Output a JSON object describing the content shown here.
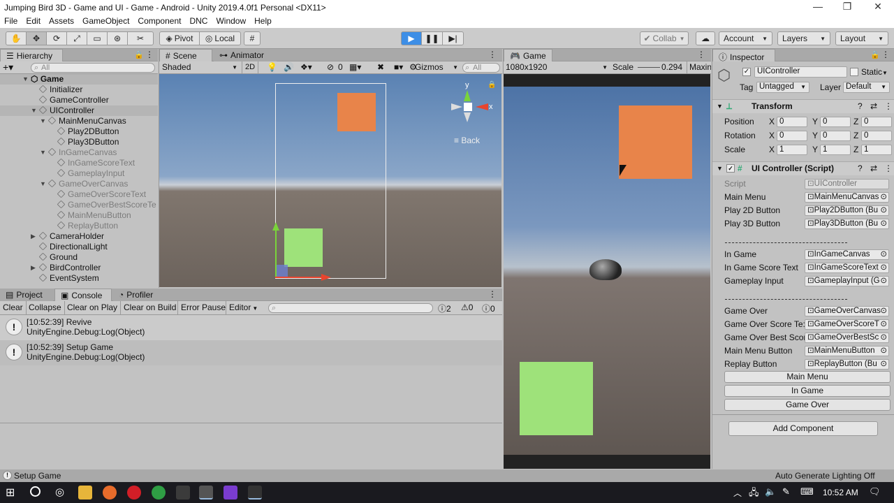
{
  "window": {
    "title": "Jumping Bird 3D - Game and UI - Game - Android - Unity 2019.4.0f1 Personal <DX11>"
  },
  "menu": [
    "File",
    "Edit",
    "Assets",
    "GameObject",
    "Component",
    "DNC",
    "Window",
    "Help"
  ],
  "toolbar": {
    "pivot": "Pivot",
    "local": "Local",
    "collab": "Collab",
    "account": "Account",
    "layers": "Layers",
    "layout": "Layout"
  },
  "hierarchy": {
    "tab": "Hierarchy",
    "search_placeholder": "All",
    "root": "Game",
    "items": [
      {
        "label": "Initializer",
        "level": 1,
        "arrow": "",
        "dim": false
      },
      {
        "label": "GameController",
        "level": 1,
        "arrow": "",
        "dim": false
      },
      {
        "label": "UIController",
        "level": 1,
        "arrow": "▼",
        "dim": false
      },
      {
        "label": "MainMenuCanvas",
        "level": 2,
        "arrow": "▼",
        "dim": false
      },
      {
        "label": "Play2DButton",
        "level": 3,
        "arrow": "",
        "dim": false
      },
      {
        "label": "Play3DButton",
        "level": 3,
        "arrow": "",
        "dim": false
      },
      {
        "label": "InGameCanvas",
        "level": 2,
        "arrow": "▼",
        "dim": true
      },
      {
        "label": "InGameScoreText",
        "level": 3,
        "arrow": "",
        "dim": true
      },
      {
        "label": "GameplayInput",
        "level": 3,
        "arrow": "",
        "dim": true
      },
      {
        "label": "GameOverCanvas",
        "level": 2,
        "arrow": "▼",
        "dim": true
      },
      {
        "label": "GameOverScoreText",
        "level": 3,
        "arrow": "",
        "dim": true
      },
      {
        "label": "GameOverBestScoreTe",
        "level": 3,
        "arrow": "",
        "dim": true
      },
      {
        "label": "MainMenuButton",
        "level": 3,
        "arrow": "",
        "dim": true
      },
      {
        "label": "ReplayButton",
        "level": 3,
        "arrow": "",
        "dim": true
      },
      {
        "label": "CameraHolder",
        "level": 1,
        "arrow": "▶",
        "dim": false
      },
      {
        "label": "DirectionalLight",
        "level": 1,
        "arrow": "",
        "dim": false
      },
      {
        "label": "Ground",
        "level": 1,
        "arrow": "",
        "dim": false
      },
      {
        "label": "BirdController",
        "level": 1,
        "arrow": "▶",
        "dim": false
      },
      {
        "label": "EventSystem",
        "level": 1,
        "arrow": "",
        "dim": false
      }
    ]
  },
  "scene": {
    "tabs": [
      "Scene",
      "Animator"
    ],
    "shading": "Shaded",
    "mode2d": "2D",
    "hidden_count": "0",
    "gizmos": "Gizmos",
    "search_placeholder": "All",
    "gizmo_back": "Back",
    "axis_y": "y",
    "axis_x": "x"
  },
  "game": {
    "tab": "Game",
    "resolution": "1080x1920",
    "scale_label": "Scale",
    "scale_value": "0.294",
    "maximize": "Maxin"
  },
  "console": {
    "tabs": [
      "Project",
      "Console",
      "Profiler"
    ],
    "buttons": [
      "Clear",
      "Collapse",
      "Clear on Play",
      "Clear on Build",
      "Error Pause",
      "Editor"
    ],
    "counts": {
      "warnings": "2",
      "info": "0",
      "errors": "0"
    },
    "logs": [
      {
        "line1": "[10:52:39] Revive",
        "line2": "UnityEngine.Debug:Log(Object)"
      },
      {
        "line1": "[10:52:39] Setup Game",
        "line2": "UnityEngine.Debug:Log(Object)"
      }
    ]
  },
  "inspector": {
    "tab": "Inspector",
    "object_name": "UIController",
    "static_label": "Static",
    "tag_label": "Tag",
    "tag_value": "Untagged",
    "layer_label": "Layer",
    "layer_value": "Default",
    "transform": {
      "title": "Transform",
      "rows": [
        {
          "label": "Position",
          "x": "0",
          "y": "0",
          "z": "0"
        },
        {
          "label": "Rotation",
          "x": "0",
          "y": "0",
          "z": "0"
        },
        {
          "label": "Scale",
          "x": "1",
          "y": "1",
          "z": "1"
        }
      ]
    },
    "script_component": {
      "title": "UI Controller (Script)",
      "script_label": "Script",
      "script_value": "UIController",
      "group1": [
        {
          "label": "Main Menu",
          "value": "MainMenuCanvas"
        },
        {
          "label": "Play 2D Button",
          "value": "Play2DButton (Bu"
        },
        {
          "label": "Play 3D Button",
          "value": "Play3DButton (Bu"
        }
      ],
      "group2": [
        {
          "label": "In Game",
          "value": "InGameCanvas"
        },
        {
          "label": "In Game Score Text",
          "value": "InGameScoreText"
        },
        {
          "label": "Gameplay Input",
          "value": "GameplayInput (G"
        }
      ],
      "group3": [
        {
          "label": "Game Over",
          "value": "GameOverCanvas"
        },
        {
          "label": "Game Over Score Te:",
          "value": "GameOverScoreT"
        },
        {
          "label": "Game Over Best Scor",
          "value": "GameOverBestSc"
        },
        {
          "label": "Main Menu Button",
          "value": "MainMenuButton"
        },
        {
          "label": "Replay Button",
          "value": "ReplayButton (Bu"
        }
      ],
      "buttons": [
        "Main Menu",
        "In Game",
        "Game Over"
      ]
    },
    "add_component": "Add Component"
  },
  "status": {
    "message": "Setup Game",
    "lighting": "Auto Generate Lighting Off"
  },
  "taskbar": {
    "time": "10:52 AM"
  },
  "colors": {
    "orange": "#e8844a",
    "green": "#9ee27a",
    "play_blue": "#3d8ee6"
  }
}
